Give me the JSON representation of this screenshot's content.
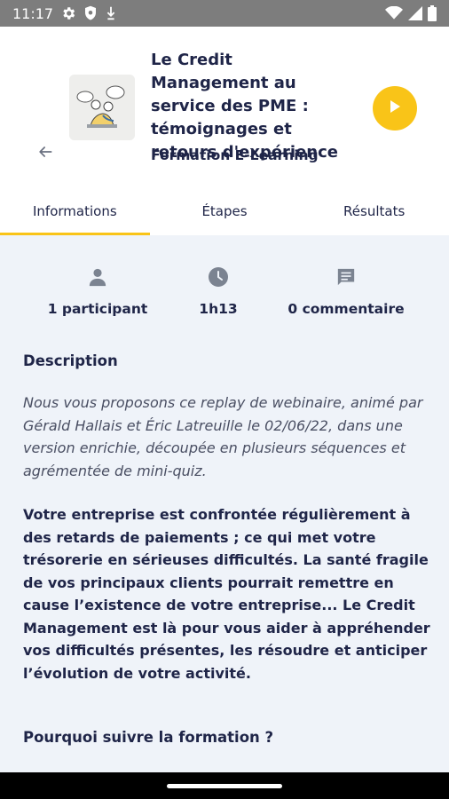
{
  "status_bar": {
    "time": "11:17"
  },
  "course": {
    "title": "Le Credit Management au service des PME : témoignages et retours d'expérience",
    "subtitle": "Formation E-Learning"
  },
  "tabs": [
    {
      "label": "Informations",
      "active": true
    },
    {
      "label": "Étapes",
      "active": false
    },
    {
      "label": "Résultats",
      "active": false
    }
  ],
  "stats": {
    "participants": "1 participant",
    "duration": "1h13",
    "comments": "0 commentaire"
  },
  "description": {
    "title": "Description",
    "intro": "Nous vous proposons ce replay de webinaire, animé par Gérald Hallais et Éric Latreuille le 02/06/22, dans une version enrichie, découpée en plusieurs séquences et agrémentée de mini-quiz.",
    "body": "Votre entreprise est confrontée régulièrement à des retards de paiements ; ce qui met votre trésorerie en sérieuses difficultés. La santé fragile de vos principaux clients pourrait remettre en cause l’existence de votre entreprise... Le Credit Management est là pour vous aider à appréhender vos difficultés présentes, les résoudre et anticiper l’évolution de votre activité.",
    "why_title": "Pourquoi suivre la formation ?"
  },
  "icons": {
    "back": "arrow-left-icon",
    "play": "play-icon",
    "participant": "person-icon",
    "duration": "clock-icon",
    "comment": "comment-icon"
  },
  "colors": {
    "accent": "#f9c418",
    "text": "#1f2548",
    "content_bg": "#eff3f9",
    "icon_gray": "#7b8391"
  }
}
